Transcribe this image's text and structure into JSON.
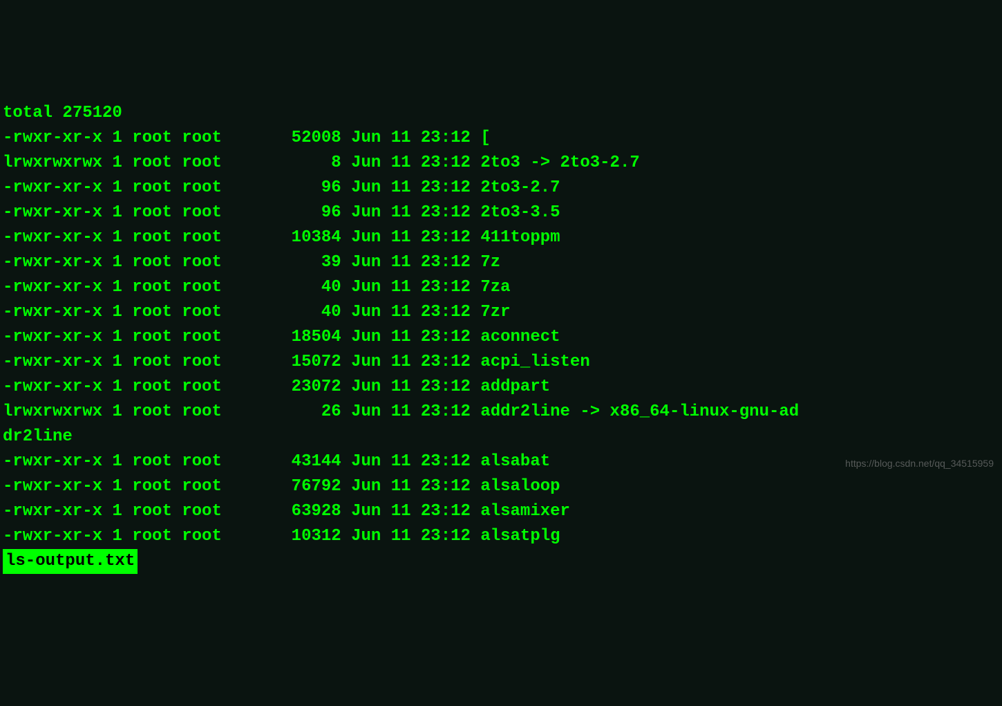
{
  "terminal": {
    "total_line": "total 275120",
    "lines": [
      "-rwxr-xr-x 1 root root       52008 Jun 11 23:12 [",
      "lrwxrwxrwx 1 root root           8 Jun 11 23:12 2to3 -> 2to3-2.7",
      "-rwxr-xr-x 1 root root          96 Jun 11 23:12 2to3-2.7",
      "-rwxr-xr-x 1 root root          96 Jun 11 23:12 2to3-3.5",
      "-rwxr-xr-x 1 root root       10384 Jun 11 23:12 411toppm",
      "-rwxr-xr-x 1 root root          39 Jun 11 23:12 7z",
      "-rwxr-xr-x 1 root root          40 Jun 11 23:12 7za",
      "-rwxr-xr-x 1 root root          40 Jun 11 23:12 7zr",
      "-rwxr-xr-x 1 root root       18504 Jun 11 23:12 aconnect",
      "-rwxr-xr-x 1 root root       15072 Jun 11 23:12 acpi_listen",
      "-rwxr-xr-x 1 root root       23072 Jun 11 23:12 addpart",
      "lrwxrwxrwx 1 root root          26 Jun 11 23:12 addr2line -> x86_64-linux-gnu-ad",
      "dr2line",
      "-rwxr-xr-x 1 root root       43144 Jun 11 23:12 alsabat",
      "-rwxr-xr-x 1 root root       76792 Jun 11 23:12 alsaloop",
      "-rwxr-xr-x 1 root root       63928 Jun 11 23:12 alsamixer",
      "-rwxr-xr-x 1 root root       10312 Jun 11 23:12 alsatplg"
    ],
    "status_bar": "ls-output.txt"
  },
  "watermark": "https://blog.csdn.net/qq_34515959"
}
